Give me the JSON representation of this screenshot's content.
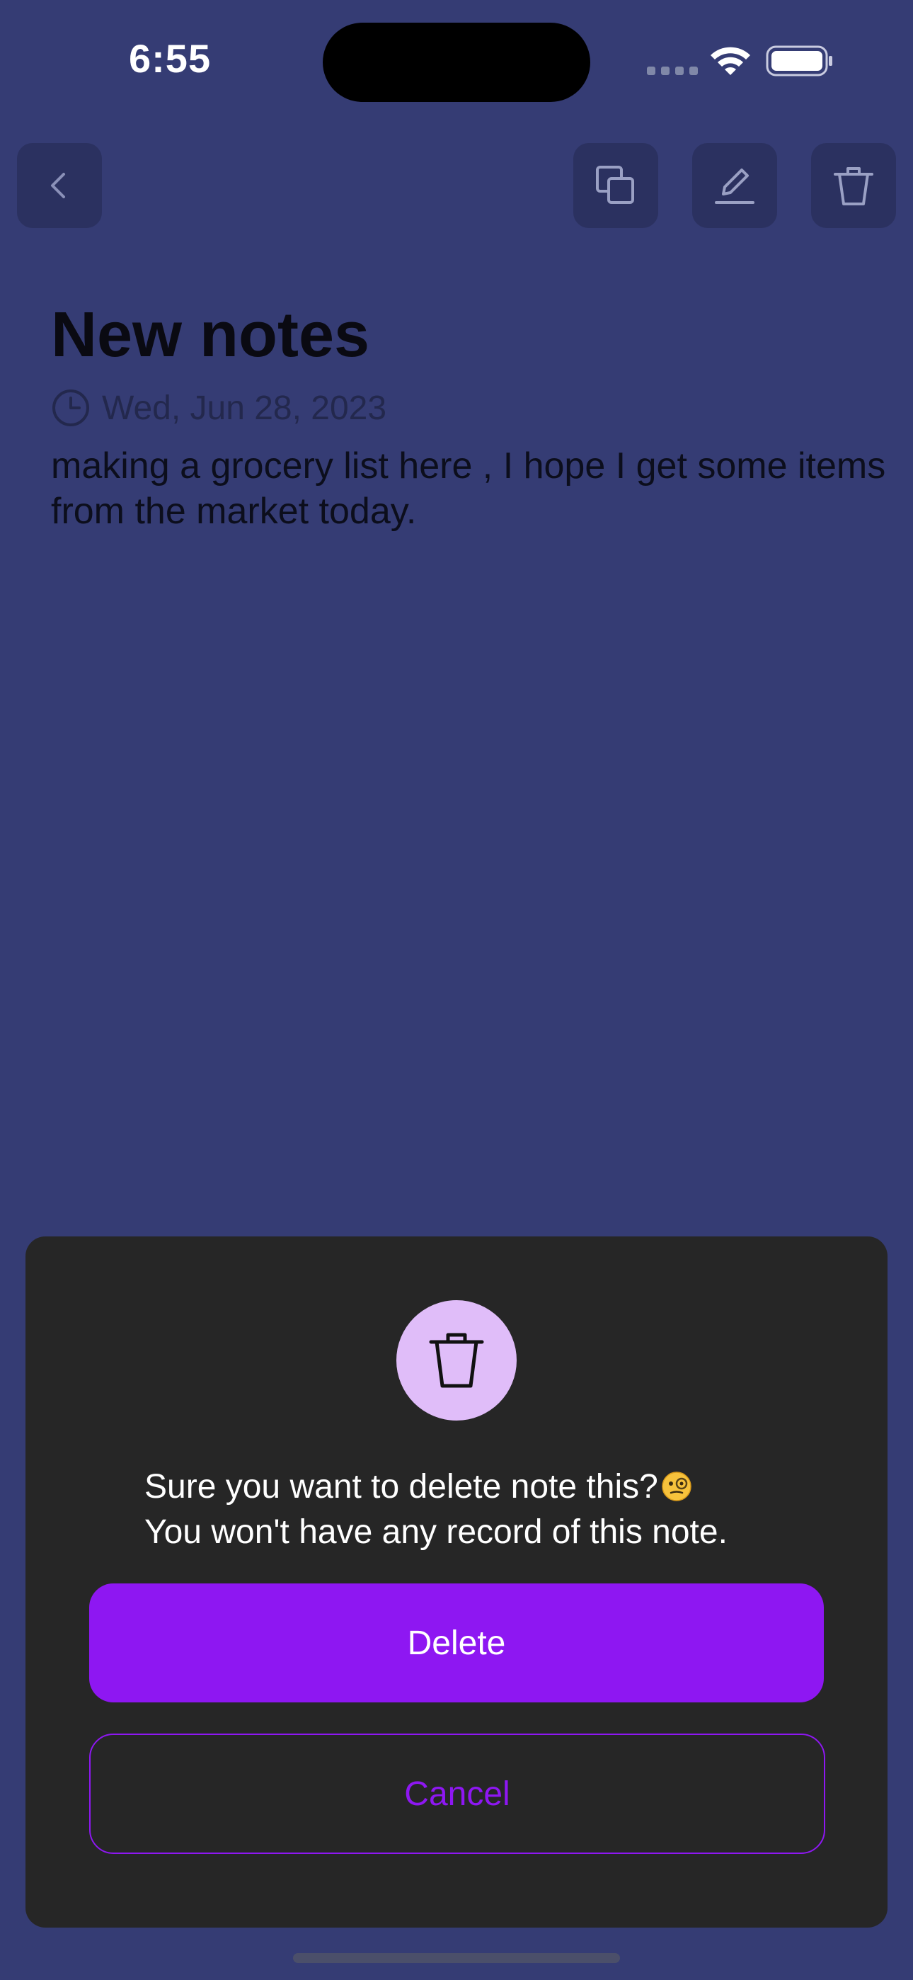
{
  "status_bar": {
    "time": "6:55"
  },
  "toolbar": {
    "back_icon": "chevron-left-icon",
    "copy_icon": "copy-icon",
    "edit_icon": "pencil-icon",
    "delete_icon": "trash-icon"
  },
  "note": {
    "title": "New notes",
    "date": "Wed, Jun 28, 2023",
    "body": "making a grocery list here , I hope I get some items from the market today."
  },
  "dialog": {
    "icon": "trash-icon",
    "message_line1": "Sure you want to delete note this?",
    "message_line2": "You won't have any record of this note.",
    "emoji": "monocle-face-emoji",
    "delete_label": "Delete",
    "cancel_label": "Cancel"
  },
  "colors": {
    "background": "#353c74",
    "button_bg": "#2b3160",
    "dialog_bg": "#262626",
    "accent_purple": "#8e17f2",
    "icon_circle": "#e0bdf9"
  }
}
